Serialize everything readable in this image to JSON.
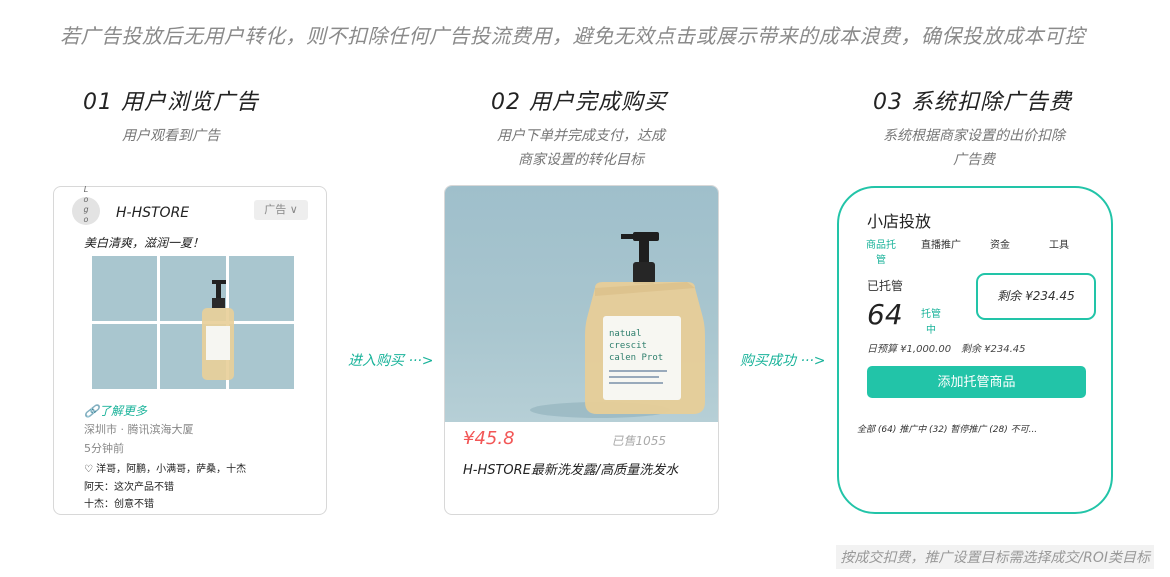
{
  "top_description": "若广告投放后无用户转化，则不扣除任何广告投流费用，避免无效点击或展示带来的成本浪费，确保投放成本可控",
  "steps": [
    {
      "title": "01 用户浏览广告",
      "subtitle_lines": [
        "用户观看到广告"
      ]
    },
    {
      "title": "02 用户完成购买",
      "subtitle_lines": [
        "用户下单并完成支付，达成",
        "商家设置的转化目标"
      ]
    },
    {
      "title": "03 系统扣除广告费",
      "subtitle_lines": [
        "系统根据商家设置的出价扣除",
        "广告费"
      ]
    }
  ],
  "arrows": [
    "进入购买 ···>",
    "购买成功 ···>"
  ],
  "ad_card": {
    "logo_text": "Logo",
    "brand": "H-HSTORE",
    "ad_tag": "广告 ∨",
    "slogan": "美白清爽，滋润一夏！",
    "more_link": "了解更多",
    "location": "深圳市 · 腾讯滨海大厦",
    "time": "5分钟前",
    "likes": "♡ 洋哥，阿鹏，小满哥，萨桑，十杰",
    "comments": [
      "阿天：这次产品不错",
      "十杰：创意不错"
    ]
  },
  "product_card": {
    "bottle_label_lines": [
      "natual",
      "crescit",
      "calen Prot"
    ],
    "price": "¥45.8",
    "sold": "已售1055",
    "name": "H-HSTORE最新洗发露/高质量洗发水"
  },
  "shop_card": {
    "title": "小店投放",
    "tabs": [
      "商品托管",
      "直播推广",
      "资金",
      "工具"
    ],
    "managed_label": "已托管",
    "managed_count": "64",
    "managed_small": "托管中",
    "remaining": "剩余 ¥234.45",
    "daily_budget": "日预算 ¥1,000.00",
    "remaining_small": "剩余 ¥234.45",
    "add_button": "添加托管商品",
    "filters": "全部 (64)   推广中 (32)   暂停推广 (28)   不可..."
  },
  "bottom_note": "按成交扣费，推广设置目标需选择成交/ROI类目标",
  "colors": {
    "accent": "#22c4a8",
    "price": "#f25656"
  }
}
